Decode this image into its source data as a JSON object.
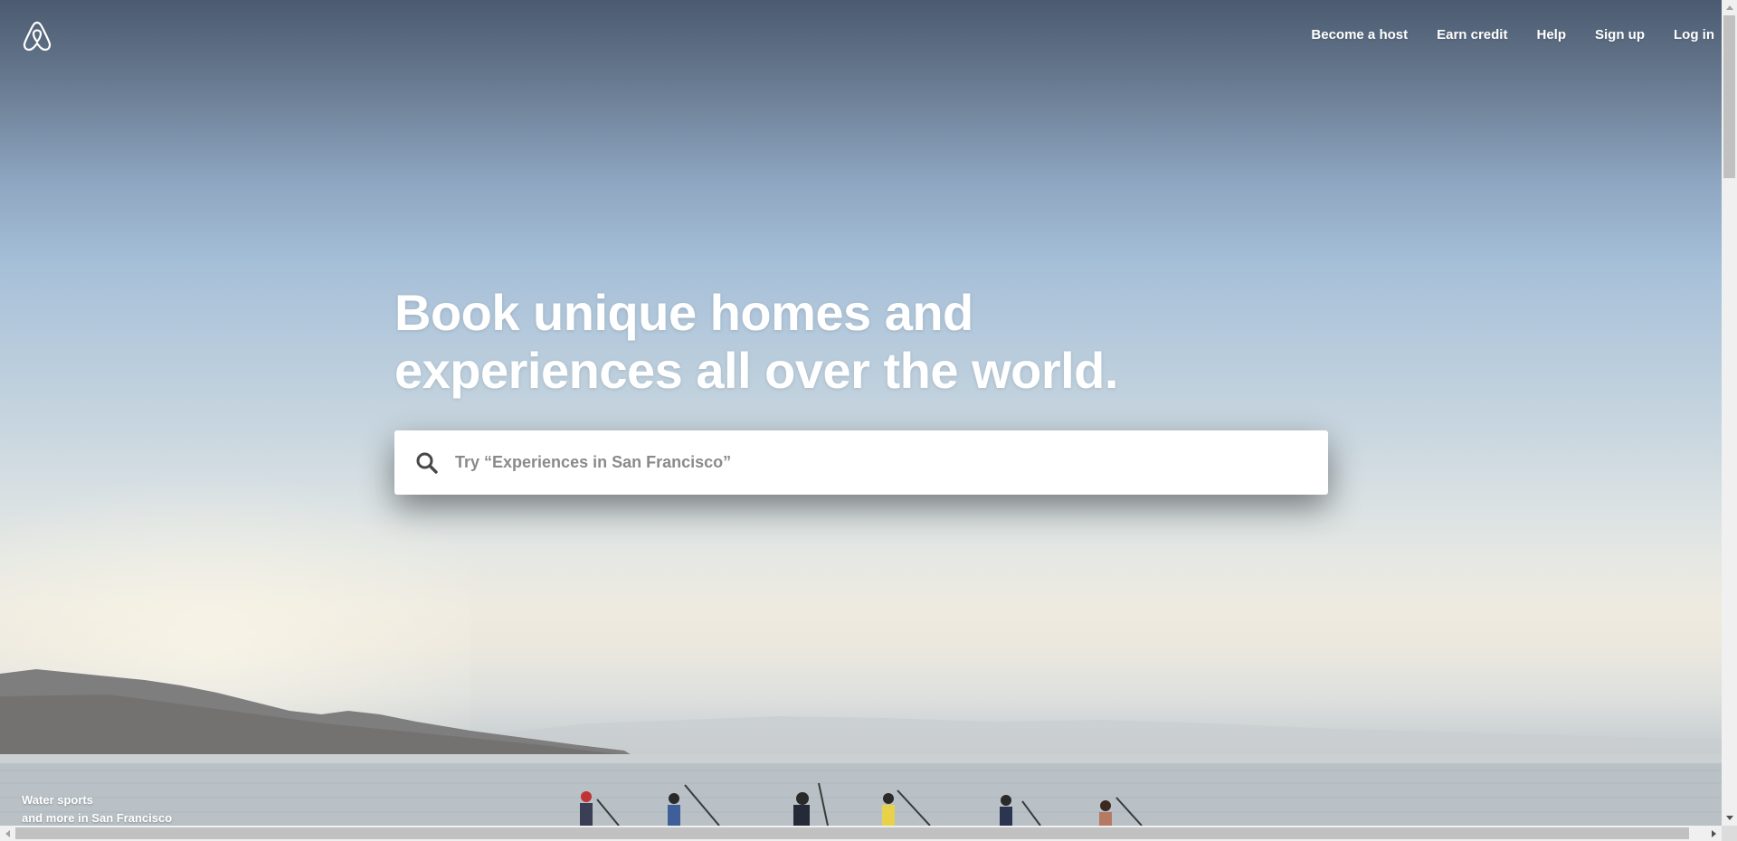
{
  "nav": {
    "logo": "airbnb-logo",
    "links": [
      {
        "label": "Become a host"
      },
      {
        "label": "Earn credit"
      },
      {
        "label": "Help"
      },
      {
        "label": "Sign up"
      },
      {
        "label": "Log in"
      }
    ]
  },
  "hero": {
    "title_line1": "Book unique homes and",
    "title_line2": "experiences all over the world."
  },
  "search": {
    "icon": "search-icon",
    "placeholder": "Try “Experiences in San Francisco”",
    "value": ""
  },
  "caption": {
    "line1": "Water sports",
    "line2": "and more in San Francisco"
  },
  "colors": {
    "brand_text": "#ffffff",
    "search_placeholder": "#8a8a8a",
    "search_icon": "#484848"
  }
}
